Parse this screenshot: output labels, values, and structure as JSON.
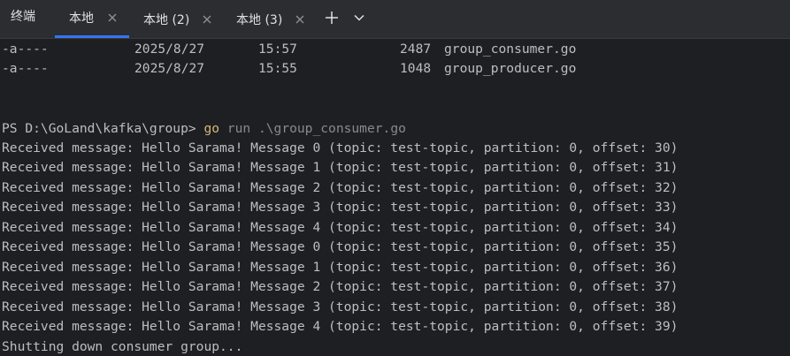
{
  "tool_window": {
    "title": "终端"
  },
  "tabs": [
    {
      "label": "本地",
      "active": true
    },
    {
      "label": "本地 (2)",
      "active": false
    },
    {
      "label": "本地 (3)",
      "active": false
    }
  ],
  "toolbar": {
    "new_tab_icon": "plus-icon",
    "dropdown_icon": "chevron-down-icon"
  },
  "terminal": {
    "listing": [
      {
        "mode": "-a----",
        "date": "2025/8/27",
        "time": "15:57",
        "size": "2487",
        "name": "group_consumer.go"
      },
      {
        "mode": "-a----",
        "date": "2025/8/27",
        "time": "15:55",
        "size": "1048",
        "name": "group_producer.go"
      }
    ],
    "prompt": "PS D:\\GoLand\\kafka\\group> ",
    "command_keyword": "go",
    "command_rest": " run .\\group_consumer.go",
    "output": [
      "Received message: Hello Sarama! Message 0 (topic: test-topic, partition: 0, offset: 30)",
      "Received message: Hello Sarama! Message 1 (topic: test-topic, partition: 0, offset: 31)",
      "Received message: Hello Sarama! Message 2 (topic: test-topic, partition: 0, offset: 32)",
      "Received message: Hello Sarama! Message 3 (topic: test-topic, partition: 0, offset: 33)",
      "Received message: Hello Sarama! Message 4 (topic: test-topic, partition: 0, offset: 34)",
      "Received message: Hello Sarama! Message 0 (topic: test-topic, partition: 0, offset: 35)",
      "Received message: Hello Sarama! Message 1 (topic: test-topic, partition: 0, offset: 36)",
      "Received message: Hello Sarama! Message 2 (topic: test-topic, partition: 0, offset: 37)",
      "Received message: Hello Sarama! Message 3 (topic: test-topic, partition: 0, offset: 38)",
      "Received message: Hello Sarama! Message 4 (topic: test-topic, partition: 0, offset: 39)",
      "Shutting down consumer group..."
    ]
  },
  "colors": {
    "background": "#1e1f22",
    "tabbar": "#2b2d30",
    "accent": "#3574f0",
    "text": "#bcbec4",
    "command_keyword": "#d5b778",
    "command_args": "#868a91"
  }
}
